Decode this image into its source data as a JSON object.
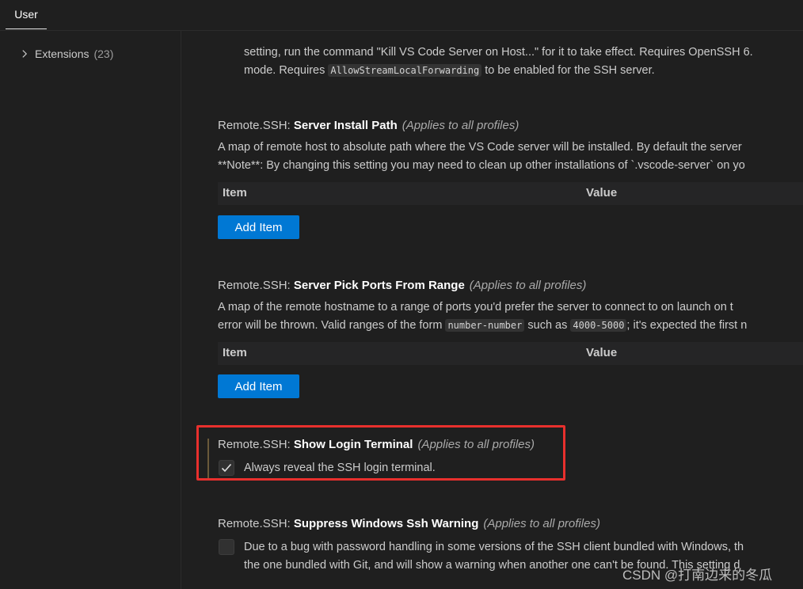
{
  "tabs": {
    "user": "User"
  },
  "toc": {
    "label": "Extensions",
    "count": "(23)"
  },
  "partial": {
    "line1": "setting, run the command \"Kill VS Code Server on Host...\" for it to take effect. Requires OpenSSH 6.",
    "line2_pre": "mode. Requires ",
    "line2_code": "AllowStreamLocalForwarding",
    "line2_post": " to be enabled for the SSH server."
  },
  "settings": {
    "server_install_path": {
      "category": "Remote.SSH: ",
      "name": "Server Install Path",
      "scope": "(Applies to all profiles)",
      "desc1": "A map of remote host to absolute path where the VS Code server will be installed. By default the server",
      "desc2": "**Note**: By changing this setting you may need to clean up other installations of `.vscode-server` on yo",
      "col_item": "Item",
      "col_value": "Value",
      "add_button": "Add Item"
    },
    "server_pick_ports": {
      "category": "Remote.SSH: ",
      "name": "Server Pick Ports From Range",
      "scope": "(Applies to all profiles)",
      "desc1": "A map of the remote hostname to a range of ports you'd prefer the server to connect to on launch on t",
      "desc2_pre": "error will be thrown. Valid ranges of the form ",
      "desc2_code1": "number-number",
      "desc2_mid": " such as ",
      "desc2_code2": "4000-5000",
      "desc2_post": "; it's expected the first n",
      "col_item": "Item",
      "col_value": "Value",
      "add_button": "Add Item"
    },
    "show_login_terminal": {
      "category": "Remote.SSH: ",
      "name": "Show Login Terminal",
      "scope": "(Applies to all profiles)",
      "checkbox_label": "Always reveal the SSH login terminal.",
      "checked": true
    },
    "suppress_windows_ssh_warning": {
      "category": "Remote.SSH: ",
      "name": "Suppress Windows Ssh Warning",
      "scope": "(Applies to all profiles)",
      "desc1": "Due to a bug with password handling in some versions of the SSH client bundled with Windows, th",
      "desc2": "the one bundled with Git, and will show a warning when another one can't be found. This setting d",
      "checked": false
    }
  },
  "watermark": "CSDN @打南边来的冬瓜",
  "colors": {
    "accent": "#0078d4",
    "highlight": "#e8302d",
    "background": "#1f1f1f"
  }
}
